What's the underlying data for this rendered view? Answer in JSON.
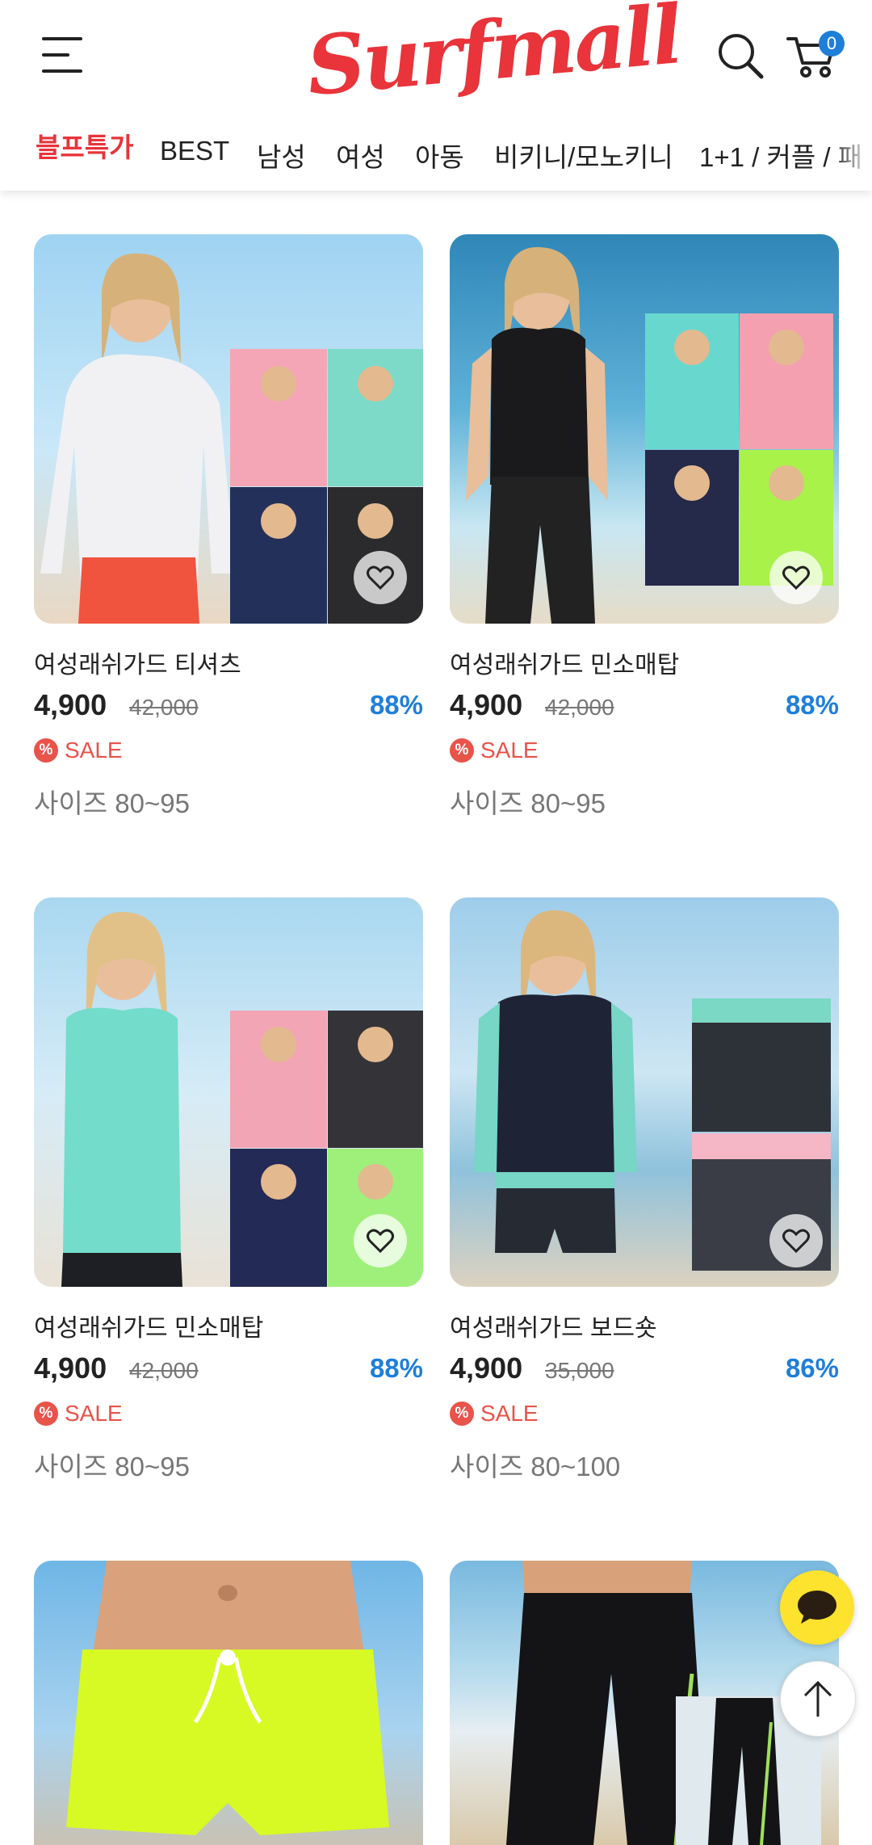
{
  "header": {
    "logo_text": "Surfmall",
    "cart_count": "0",
    "icons": {
      "menu": "hamburger-menu-icon",
      "search": "search-icon",
      "cart": "cart-icon"
    },
    "categories": [
      {
        "label": "블프특가",
        "highlight": true
      },
      {
        "label": "BEST"
      },
      {
        "label": "남성"
      },
      {
        "label": "여성"
      },
      {
        "label": "아동"
      },
      {
        "label": "비키니/모노키니"
      },
      {
        "label": "1+1 / 커플 / 패"
      }
    ]
  },
  "colors": {
    "brand": "#e8343a",
    "discount": "#1e7fd9",
    "sale": "#e8534a"
  },
  "products": [
    {
      "name": "여성래쉬가드 티셔츠",
      "price": "4,900",
      "original_price": "42,000",
      "discount": "88%",
      "sale_label": "SALE",
      "size": "사이즈 80~95"
    },
    {
      "name": "여성래쉬가드 민소매탑",
      "price": "4,900",
      "original_price": "42,000",
      "discount": "88%",
      "sale_label": "SALE",
      "size": "사이즈 80~95"
    },
    {
      "name": "여성래쉬가드 민소매탑",
      "price": "4,900",
      "original_price": "42,000",
      "discount": "88%",
      "sale_label": "SALE",
      "size": "사이즈 80~95"
    },
    {
      "name": "여성래쉬가드 보드숏",
      "price": "4,900",
      "original_price": "35,000",
      "discount": "86%",
      "sale_label": "SALE",
      "size": "사이즈 80~100"
    }
  ],
  "floating": {
    "chat_icon": "chat-bubble-icon",
    "top_icon": "arrow-up-icon"
  }
}
